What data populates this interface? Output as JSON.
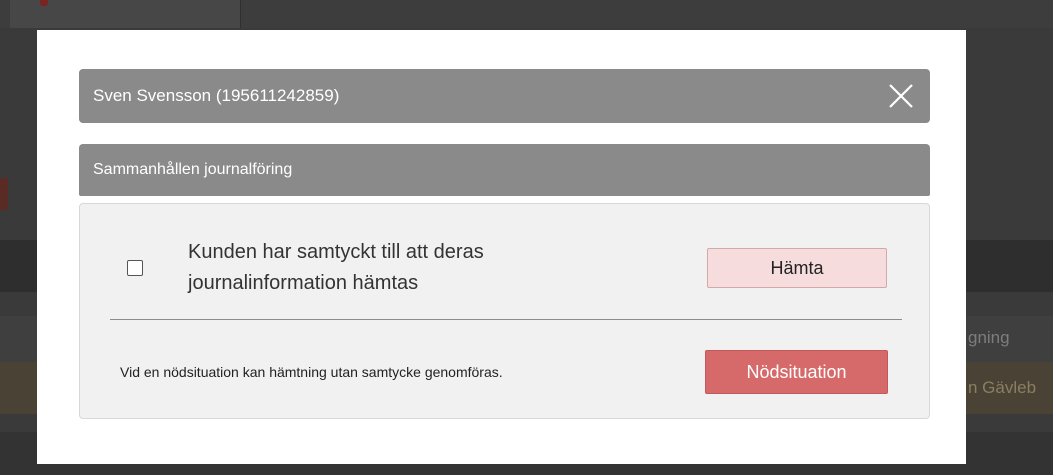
{
  "background": {
    "text_1": "gning",
    "text_2": "n Gävleb"
  },
  "modal": {
    "header_title": "Sven Svensson (195611242859)",
    "close_icon": "close-icon",
    "section_title": "Sammanhållen journalföring",
    "consent_text": "Kunden har samtyckt till att deras journalinformation hämtas",
    "consent_checked": false,
    "fetch_button_label": "Hämta",
    "emergency_text": "Vid en nödsituation kan hämtning utan samtycke genomföras.",
    "emergency_button_label": "Nödsituation"
  },
  "colors": {
    "header_bg": "#8a8a8a",
    "fetch_button_bg": "#f6dcdc",
    "emergency_button_bg": "#d66a6a"
  }
}
